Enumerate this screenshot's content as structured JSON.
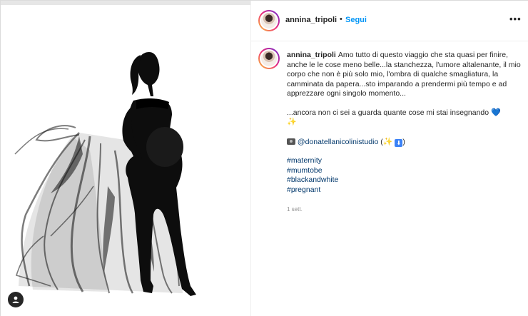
{
  "header": {
    "username": "annina_tripoli",
    "separator": "•",
    "follow_label": "Segui",
    "more_label": "•••"
  },
  "caption": {
    "username": "annina_tripoli",
    "text": "Amo tutto di questo viaggio che sta quasi per finire, anche le le cose meno belle...la stanchezza, l'umore altalenante, il mio corpo che non è più solo mio, l'ombra di qualche smagliatura, la camminata da papera...sto imparando a prendermi più tempo e ad apprezzare ogni singolo momento...",
    "line2": "...ancora non ci sei a guarda quante cose mi stai insegnando",
    "heart": "💙",
    "sparkle": "✨",
    "credit_mention": "@donatellanicolinistudio",
    "credit_open": " (",
    "credit_close": ")",
    "hashtags": [
      "#maternity",
      "#mumtobe",
      "#blackandwhite",
      "#pregnant"
    ]
  },
  "timestamp": "1 sett.",
  "icons": {
    "user_tag": "user-tag-icon",
    "camera": "camera-icon",
    "download": "download-box-icon"
  },
  "colors": {
    "follow": "#0095f6",
    "link": "#00376b",
    "text": "#262626",
    "muted": "#8e8e8e"
  }
}
